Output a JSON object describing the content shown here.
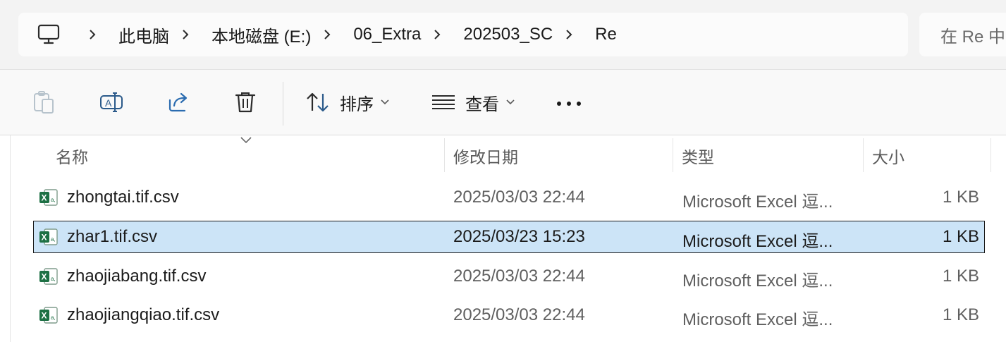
{
  "address": {
    "crumbs": [
      "此电脑",
      "本地磁盘 (E:)",
      "06_Extra",
      "202503_SC",
      "Re"
    ],
    "search_placeholder": "在 Re 中"
  },
  "toolbar": {
    "sort_label": "排序",
    "view_label": "查看"
  },
  "columns": {
    "name": "名称",
    "modified": "修改日期",
    "type": "类型",
    "size": "大小"
  },
  "files": [
    {
      "name": "zhongtai.tif.csv",
      "modified": "2025/03/03 22:44",
      "type": "Microsoft Excel 逗...",
      "size": "1 KB",
      "selected": false
    },
    {
      "name": "zhar1.tif.csv",
      "modified": "2025/03/23 15:23",
      "type": "Microsoft Excel 逗...",
      "size": "1 KB",
      "selected": true
    },
    {
      "name": "zhaojiabang.tif.csv",
      "modified": "2025/03/03 22:44",
      "type": "Microsoft Excel 逗...",
      "size": "1 KB",
      "selected": false
    },
    {
      "name": "zhaojiangqiao.tif.csv",
      "modified": "2025/03/03 22:44",
      "type": "Microsoft Excel 逗...",
      "size": "1 KB",
      "selected": false
    }
  ],
  "icons": {
    "computer": "computer-icon",
    "excel": "excel-csv-file-icon"
  },
  "colors": {
    "selection": "#cce4f7",
    "excel_green": "#1d7044"
  }
}
